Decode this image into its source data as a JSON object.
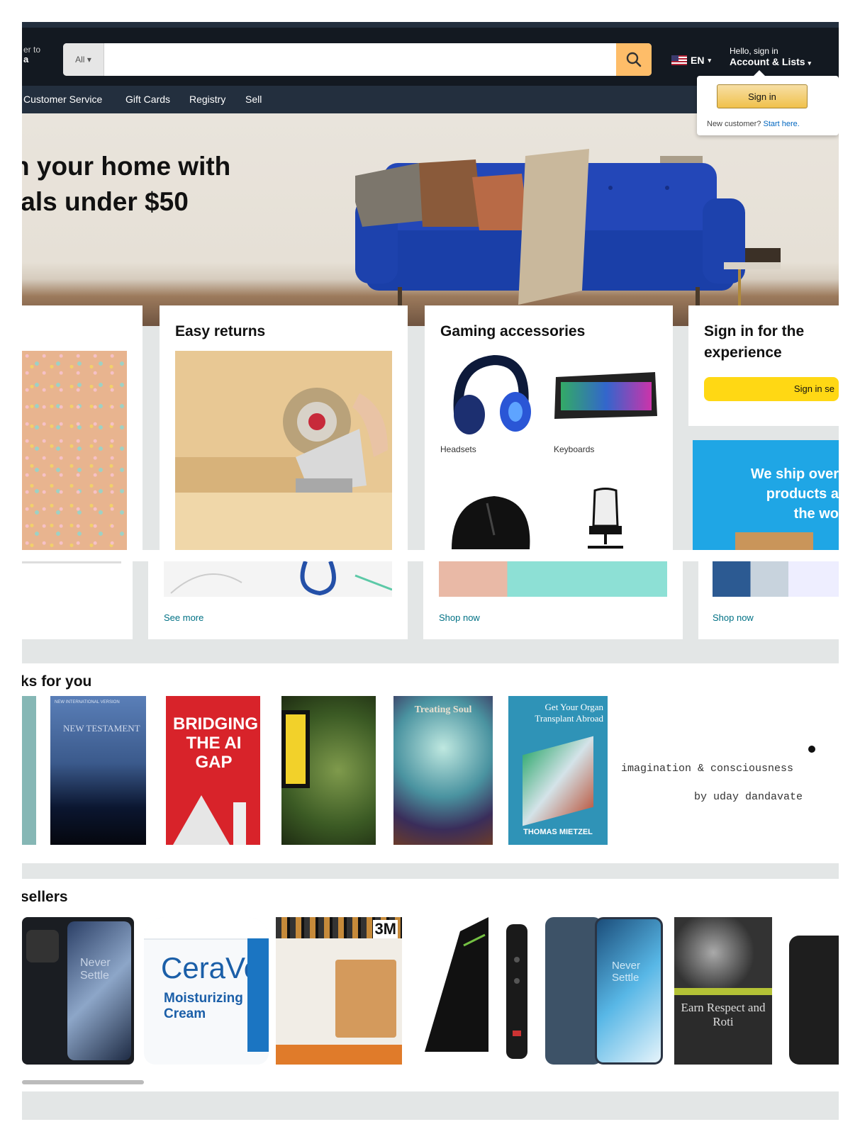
{
  "header": {
    "deliver_line1": "er to",
    "deliver_line2": "a",
    "search_category": "All",
    "search_value": "",
    "language": "EN",
    "account_line1": "Hello, sign in",
    "account_line2": "Account & Lists"
  },
  "nav": {
    "items": [
      "Customer Service",
      "Gift Cards",
      "Registry",
      "Sell"
    ]
  },
  "signin_flyout": {
    "button": "Sign in",
    "new_customer": "New customer?",
    "start_here": "Start here."
  },
  "hero": {
    "line1": "h your home with",
    "line2": "ials under $50"
  },
  "cards": {
    "easy_returns": {
      "title": "Easy returns",
      "link": "See more"
    },
    "gaming": {
      "title": "Gaming accessories",
      "items": [
        "Headsets",
        "Keyboards"
      ],
      "link": "Shop now"
    },
    "signin_card": {
      "title_line1": "Sign in for the",
      "title_line2": "experience",
      "button": "Sign in se",
      "ship_line1": "We ship over",
      "ship_line2": "products a",
      "ship_line3": "the wo",
      "link": "Shop now"
    }
  },
  "books_row": {
    "title": "ks for you",
    "books": [
      {
        "title": "NEW TESTAMENT",
        "sub": "NEW INTERNATIONAL VERSION"
      },
      {
        "title": "BRIDGING THE AI GAP"
      },
      {
        "title": ""
      },
      {
        "title": "Treating Soul"
      },
      {
        "title": "Get Your Organ Transplant Abroad",
        "author": "THOMAS MIETZEL"
      }
    ],
    "quote_line1": "imagination & consciousness",
    "quote_line2": "by uday dandavate"
  },
  "sellers_row": {
    "title": "sellers",
    "products": [
      {
        "text": "Never Settle"
      },
      {
        "text": "CeraVe",
        "sub1": "Moisturizing",
        "sub2": "Cream"
      },
      {
        "text": "3M"
      },
      {
        "text": ""
      },
      {
        "text": "Never Settle"
      },
      {
        "text": "Earn Respect and Roti"
      }
    ]
  },
  "colors": {
    "topbar": "#131921",
    "nav": "#232f3e",
    "search_button": "#febd69",
    "link": "#007185",
    "yellow_button": "#ffd814"
  }
}
